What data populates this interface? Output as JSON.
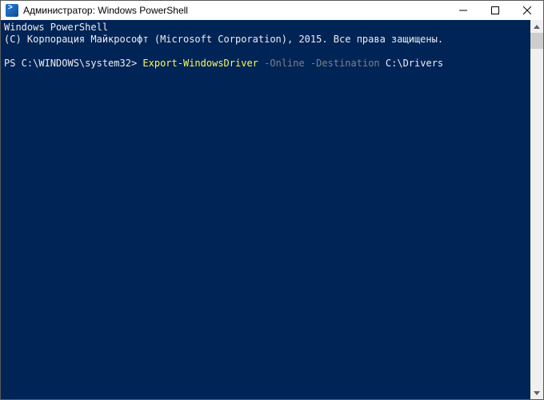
{
  "window": {
    "title": "Администратор: Windows PowerShell",
    "icon": "powershell-icon"
  },
  "console": {
    "header_line1": "Windows PowerShell",
    "header_line2": "(C) Корпорация Майкрософт (Microsoft Corporation), 2015. Все права защищены.",
    "prompt": "PS C:\\WINDOWS\\system32>",
    "cmdlet": "Export-WindowsDriver",
    "param1": "-Online",
    "param2": "-Destination",
    "arg2": "C:\\Drivers"
  },
  "colors": {
    "console_bg": "#012456",
    "console_fg": "#eeedf0",
    "cmdlet": "#fafa5a",
    "param": "#808080"
  }
}
